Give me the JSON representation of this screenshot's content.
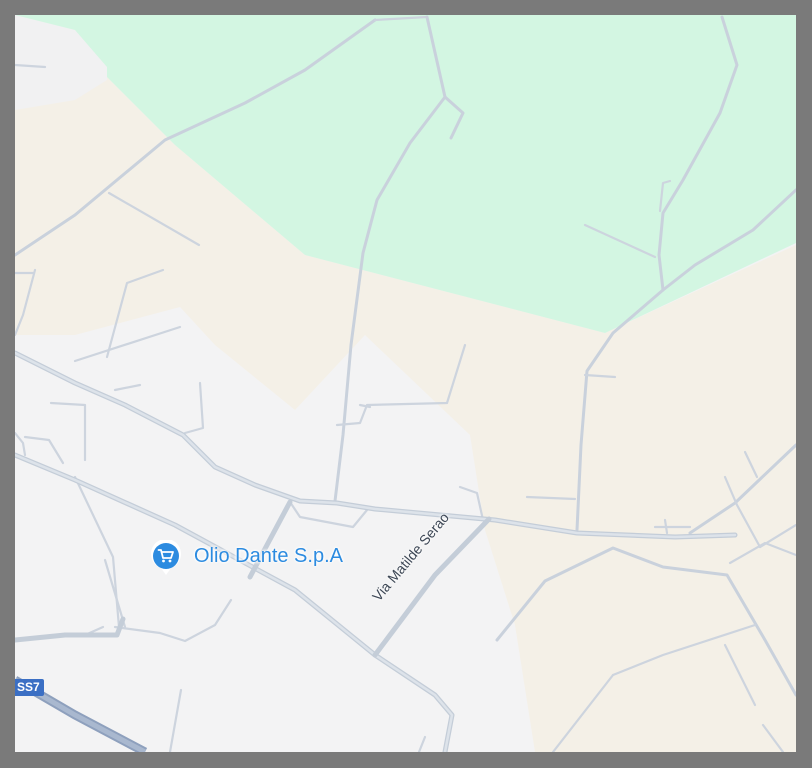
{
  "map": {
    "colors": {
      "frame": "#7a7a7a",
      "background": "#f3f3f4",
      "park": "#d3f6e2",
      "land": "#f4f0e7",
      "urban_light": "#f1f1f2",
      "road": "#c9d1dc",
      "highway": "#8ea0bd",
      "poi_blue": "#2c8be0",
      "shield_blue": "#3b6fc4"
    },
    "poi": {
      "name": "Olio Dante S.p.A",
      "icon": "shopping-cart-icon"
    },
    "streets": [
      {
        "name": "Via Matilde Serao"
      }
    ],
    "route_shields": [
      {
        "label": "SS7"
      }
    ]
  }
}
